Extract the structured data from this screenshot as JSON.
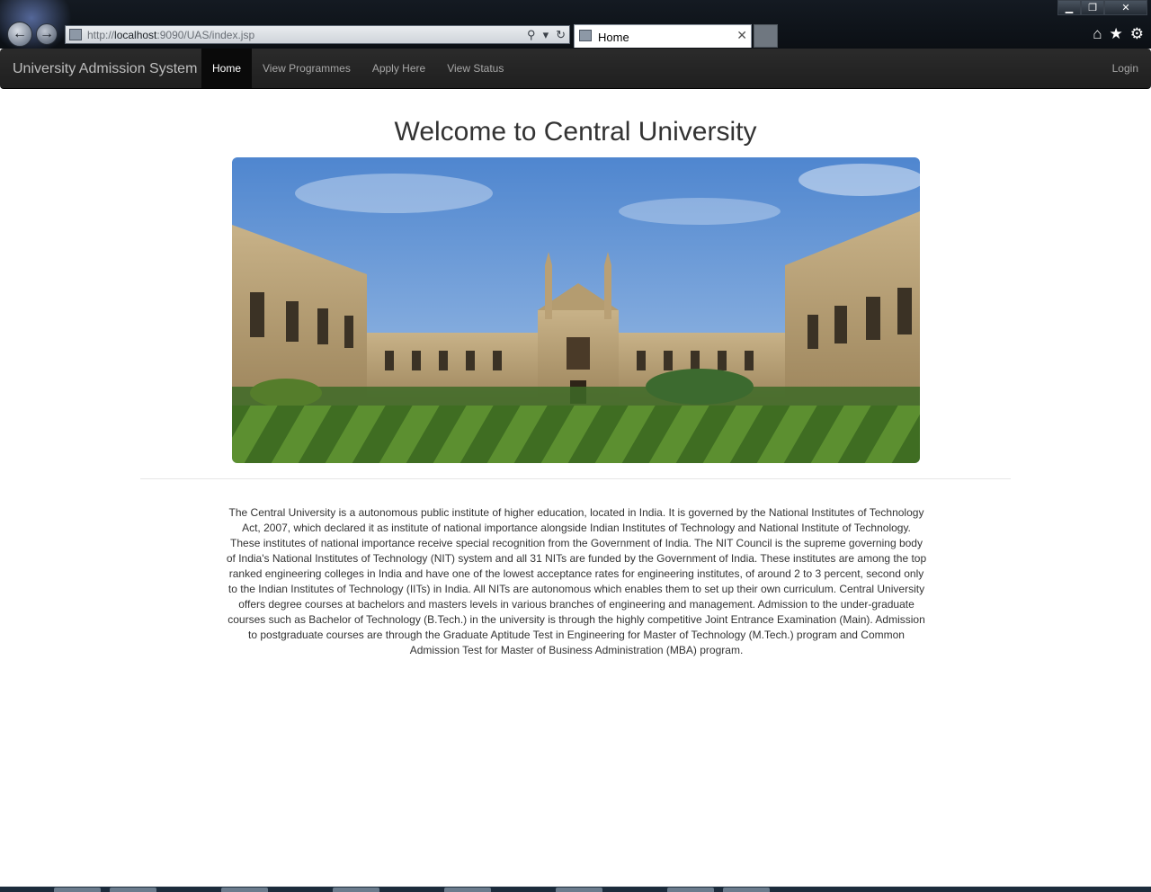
{
  "browser": {
    "url_protocol": "http://",
    "url_host": "localhost",
    "url_rest": ":9090/UAS/index.jsp",
    "tab_title": "Home",
    "tab_close": "✕",
    "win_minimize": "▁",
    "win_restore": "❐",
    "win_close": "✕"
  },
  "navbar": {
    "brand": "University Admission System",
    "items": [
      {
        "label": "Home",
        "active": true
      },
      {
        "label": "View Programmes"
      },
      {
        "label": "Apply Here"
      },
      {
        "label": "View Status"
      }
    ],
    "login": "Login"
  },
  "main": {
    "title": "Welcome to Central University",
    "paragraph": "The Central University is a autonomous public institute of higher education, located in India. It is governed by the National Institutes of Technology Act, 2007, which declared it as institute of national importance alongside Indian Institutes of Technology and National Institute of Technology. These institutes of national importance receive special recognition from the Government of India. The NIT Council is the supreme governing body of India's National Institutes of Technology (NIT) system and all 31 NITs are funded by the Government of India. These institutes are among the top ranked engineering colleges in India and have one of the lowest acceptance rates for engineering institutes, of around 2 to 3 percent, second only to the Indian Institutes of Technology (IITs) in India. All NITs are autonomous which enables them to set up their own curriculum. Central University offers degree courses at bachelors and masters levels in various branches of engineering and management. Admission to the under-graduate courses such as Bachelor of Technology (B.Tech.) in the university is through the highly competitive Joint Entrance Examination (Main). Admission to postgraduate courses are through the Graduate Aptitude Test in Engineering for Master of Technology (M.Tech.) program and Common Admission Test for Master of Business Administration (MBA) program."
  },
  "colors": {
    "navbar_bg": "#222222",
    "nav_active_bg": "#0a0a0a",
    "sky": "#6f9fd8",
    "lawn": "#4c7a2a",
    "stone": "#b59d72"
  }
}
